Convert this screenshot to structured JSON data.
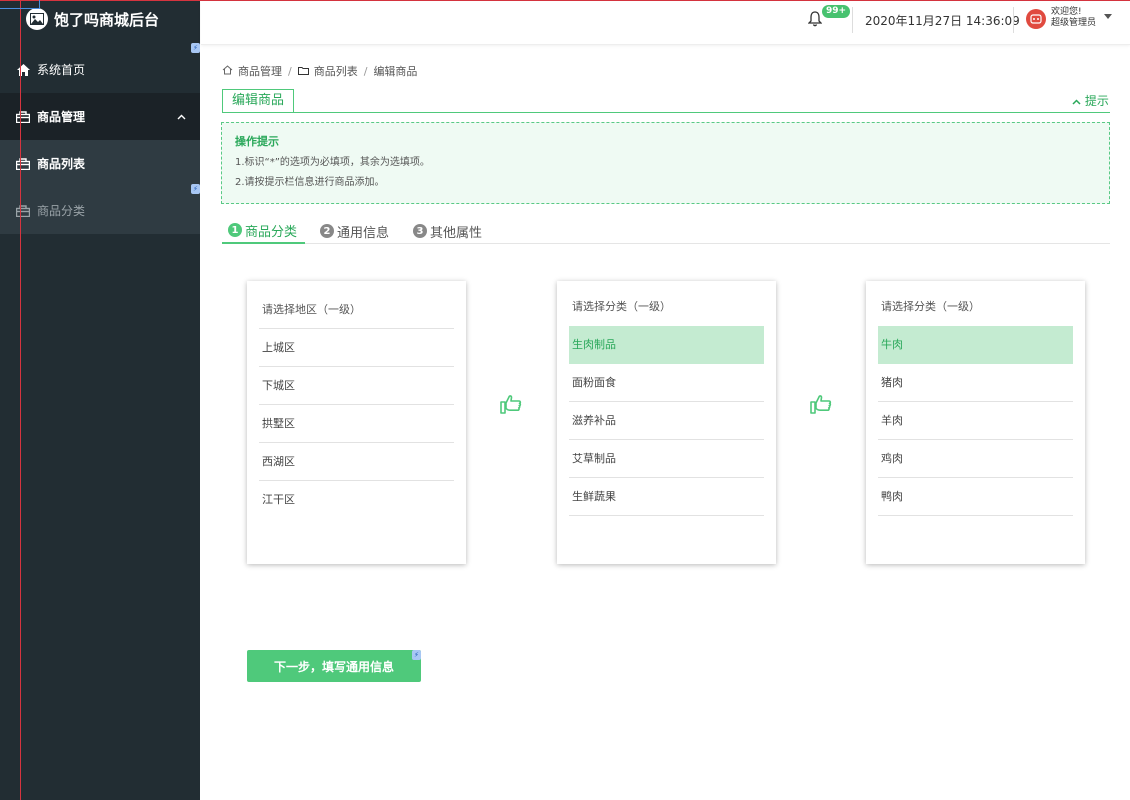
{
  "app": {
    "title": "饱了吗商城后台"
  },
  "sidebar": {
    "items": [
      {
        "label": "系统首页"
      },
      {
        "label": "商品管理"
      },
      {
        "label": "商品列表"
      },
      {
        "label": "商品分类"
      }
    ]
  },
  "header": {
    "notification_count": "99+",
    "datetime": "2020年11月27日 14:36:09",
    "welcome": "欢迎您!",
    "role": "超级管理员"
  },
  "breadcrumb": [
    "商品管理",
    "商品列表",
    "编辑商品"
  ],
  "page": {
    "title": "编辑商品",
    "tip_toggle": "提示",
    "tips": {
      "title": "操作提示",
      "lines": [
        "1.标识“*”的选项为必填项，其余为选填项。",
        "2.请按提示栏信息进行商品添加。"
      ]
    }
  },
  "steps": [
    {
      "num": "1",
      "label": "商品分类"
    },
    {
      "num": "2",
      "label": "通用信息"
    },
    {
      "num": "3",
      "label": "其他属性"
    }
  ],
  "panels": [
    {
      "header": "请选择地区（一级）",
      "items": [
        "上城区",
        "下城区",
        "拱墅区",
        "西湖区",
        "江干区"
      ],
      "selected": null
    },
    {
      "header": "请选择分类（一级）",
      "items": [
        "生肉制品",
        "面粉面食",
        "滋养补品",
        "艾草制品",
        "生鲜蔬果"
      ],
      "selected": "生肉制品"
    },
    {
      "header": "请选择分类（一级）",
      "items": [
        "牛肉",
        "猪肉",
        "羊肉",
        "鸡肉",
        "鸭肉"
      ],
      "selected": "牛肉"
    }
  ],
  "next_button": "下一步，填写通用信息",
  "colors": {
    "primary": "#4fc97b",
    "sidebar": "#222d33",
    "selected_bg": "#c4ebd1",
    "badge": "#47c26f"
  }
}
